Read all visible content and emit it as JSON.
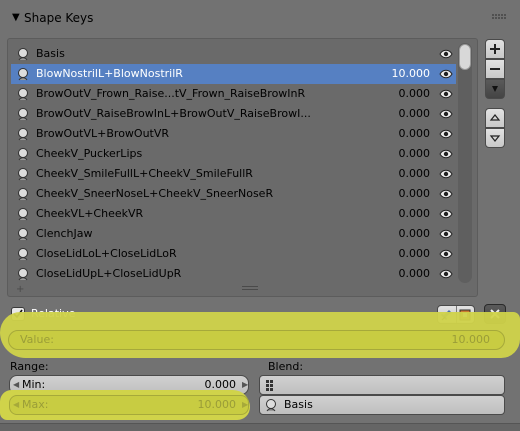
{
  "panel": {
    "title": "Shape Keys"
  },
  "shape_keys": [
    {
      "name": "Basis",
      "value": "",
      "selected": false
    },
    {
      "name": "BlowNostrilL+BlowNostrilR",
      "value": "10.000",
      "selected": true
    },
    {
      "name": "BrowOutV_Frown_Raise...tV_Frown_RaiseBrowInR",
      "value": "0.000",
      "selected": false
    },
    {
      "name": "BrowOutV_RaiseBrowInL+BrowOutV_RaiseBrowI...",
      "value": "0.000",
      "selected": false
    },
    {
      "name": "BrowOutVL+BrowOutVR",
      "value": "0.000",
      "selected": false
    },
    {
      "name": "CheekV_PuckerLips",
      "value": "0.000",
      "selected": false
    },
    {
      "name": "CheekV_SmileFullL+CheekV_SmileFullR",
      "value": "0.000",
      "selected": false
    },
    {
      "name": "CheekV_SneerNoseL+CheekV_SneerNoseR",
      "value": "0.000",
      "selected": false
    },
    {
      "name": "CheekVL+CheekVR",
      "value": "0.000",
      "selected": false
    },
    {
      "name": "ClenchJaw",
      "value": "0.000",
      "selected": false
    },
    {
      "name": "CloseLidLoL+CloseLidLoR",
      "value": "0.000",
      "selected": false
    },
    {
      "name": "CloseLidUpL+CloseLidUpR",
      "value": "0.000",
      "selected": false
    }
  ],
  "relative": {
    "label": "Relative",
    "checked": true
  },
  "value_field": {
    "label": "Value:",
    "value": "10.000"
  },
  "range": {
    "label": "Range:",
    "min_label": "Min:",
    "min_value": "0.000",
    "max_label": "Max:",
    "max_value": "10.000"
  },
  "blend": {
    "label": "Blend:",
    "vertex_group": "",
    "relative_key": "Basis"
  },
  "colors": {
    "selection": "#5680c2",
    "highlight": "#d0d34a",
    "panel_bg": "#727272"
  }
}
